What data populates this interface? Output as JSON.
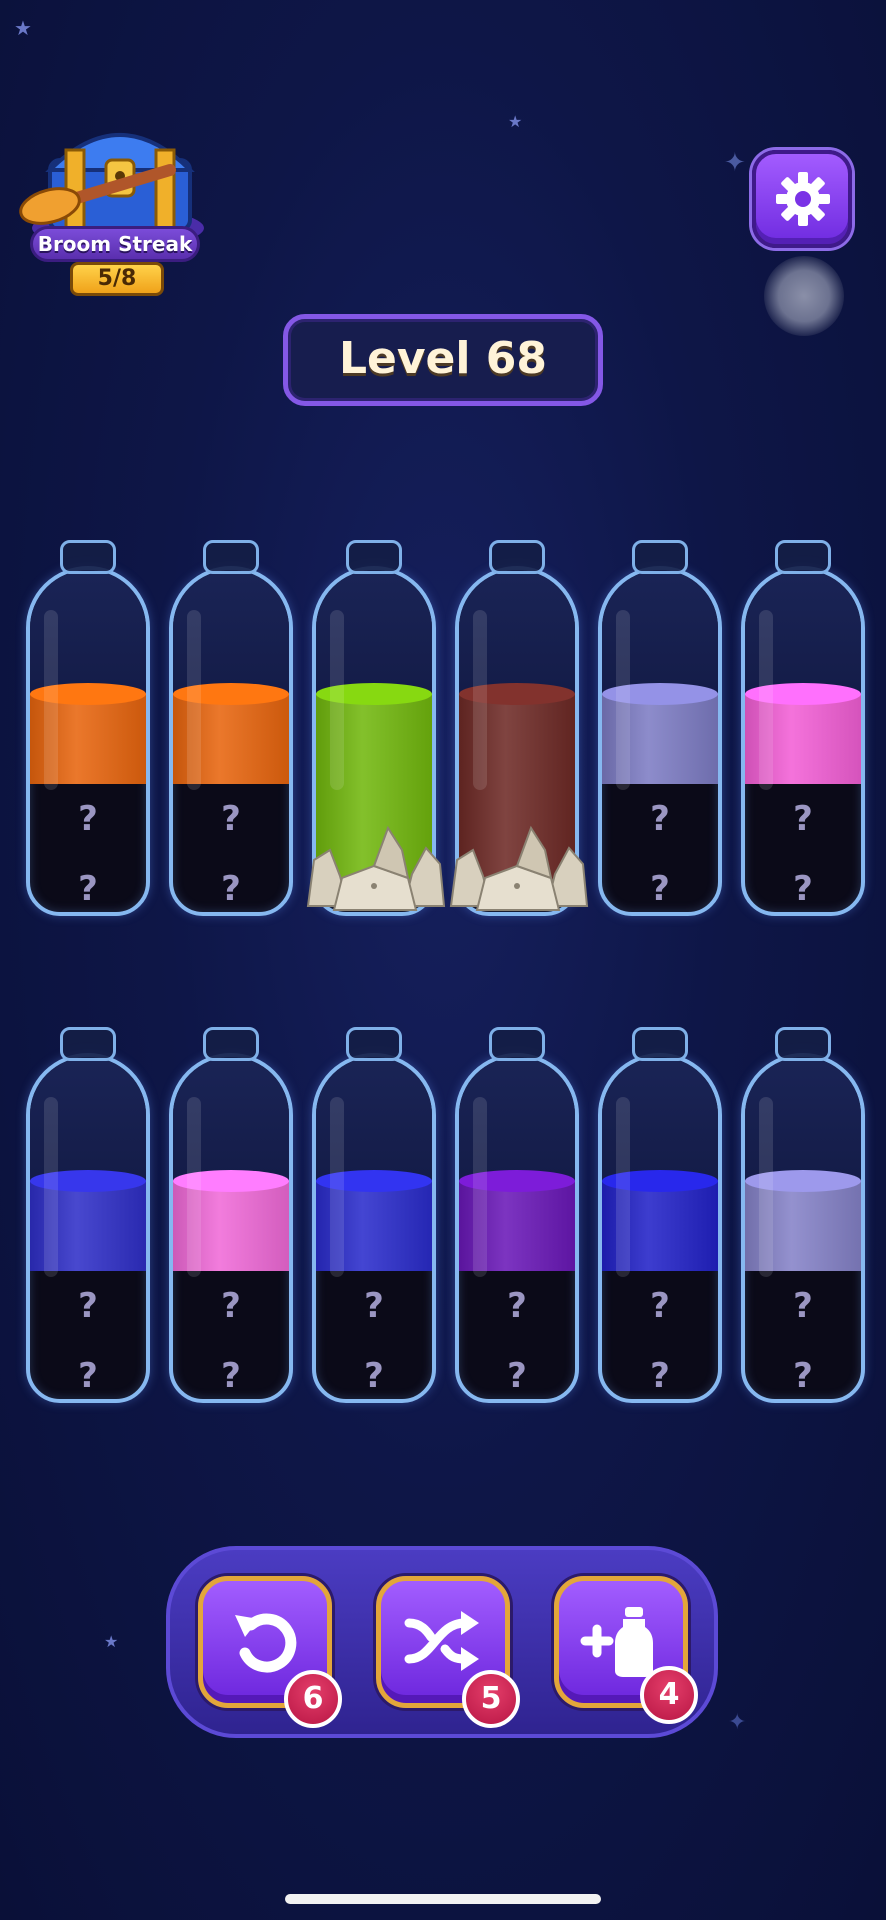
{
  "streak": {
    "label": "Broom Streak",
    "count": "5/8",
    "icon": "treasure-chest-broom"
  },
  "settings": {
    "icon": "gear-icon"
  },
  "level": {
    "label": "Level 68"
  },
  "bottles": [
    {
      "top_color": "#e8650e",
      "hidden": [
        "?",
        "?"
      ],
      "locked": false
    },
    {
      "top_color": "#e8650e",
      "hidden": [
        "?",
        "?"
      ],
      "locked": false
    },
    {
      "top_color": "#72b80e",
      "hidden": [],
      "locked": true
    },
    {
      "top_color": "#6e2a26",
      "hidden": [],
      "locked": true
    },
    {
      "top_color": "#7d7cc4",
      "hidden": [
        "?",
        "?"
      ],
      "locked": false
    },
    {
      "top_color": "#f35fd6",
      "hidden": [
        "?",
        "?"
      ],
      "locked": false
    },
    {
      "top_color": "#2f2fc8",
      "hidden": [
        "?",
        "?"
      ],
      "locked": false
    },
    {
      "top_color": "#f06ad8",
      "hidden": [
        "?",
        "?"
      ],
      "locked": false
    },
    {
      "top_color": "#2a2ccc",
      "hidden": [
        "?",
        "?"
      ],
      "locked": false
    },
    {
      "top_color": "#6a18b8",
      "hidden": [
        "?",
        "?"
      ],
      "locked": false
    },
    {
      "top_color": "#2222c8",
      "hidden": [
        "?",
        "?"
      ],
      "locked": false
    },
    {
      "top_color": "#8582c8",
      "hidden": [
        "?",
        "?"
      ],
      "locked": false
    }
  ],
  "tools": [
    {
      "icon": "undo-icon",
      "count": "6"
    },
    {
      "icon": "shuffle-icon",
      "count": "5"
    },
    {
      "icon": "add-bottle-icon",
      "count": "4"
    }
  ]
}
